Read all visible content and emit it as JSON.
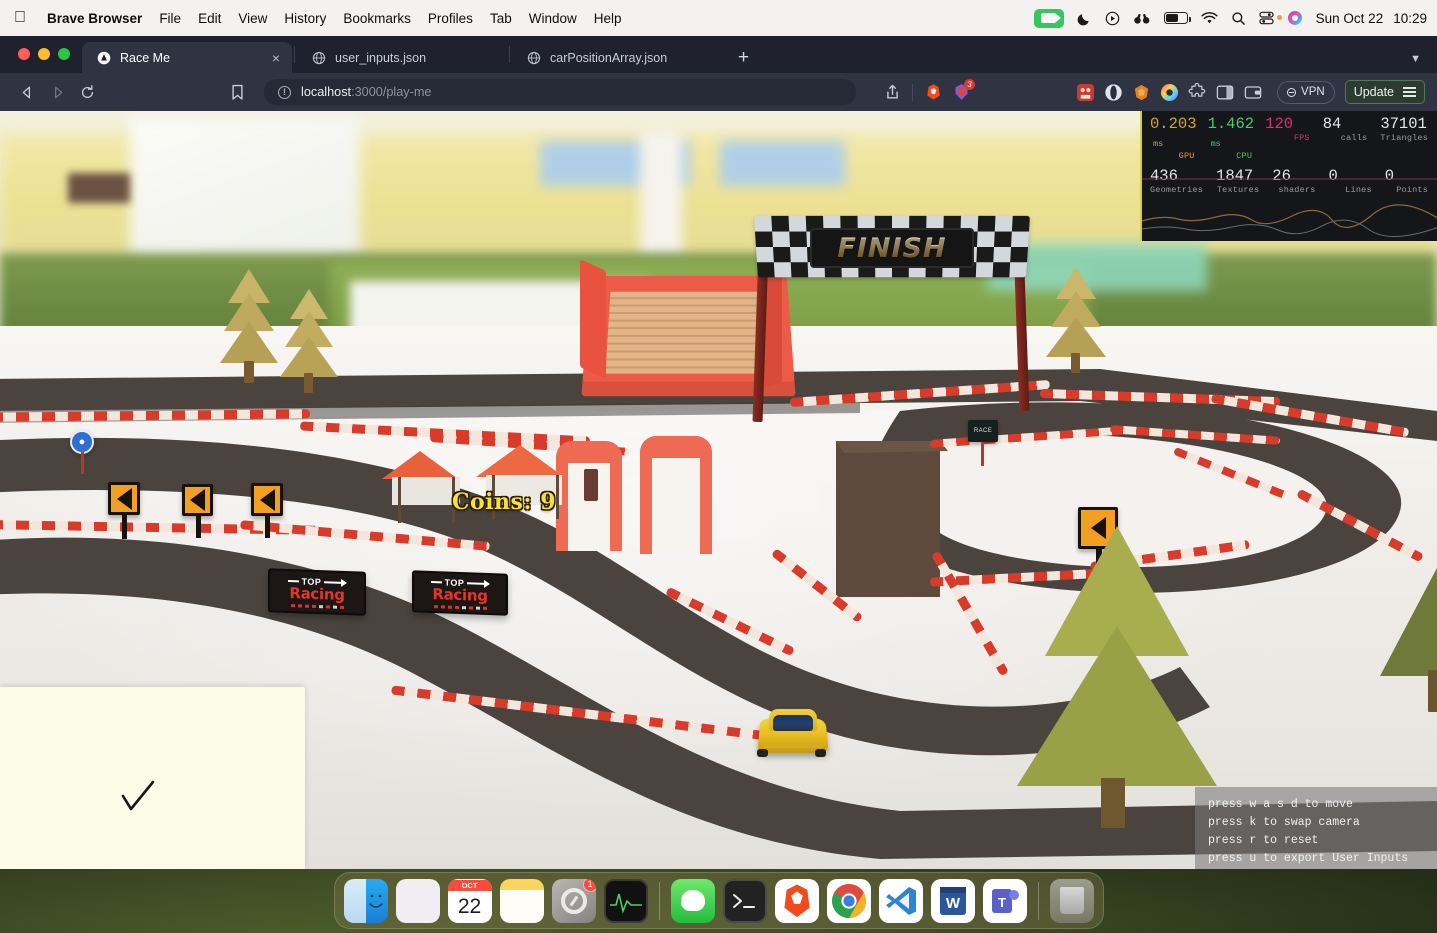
{
  "menubar": {
    "apple_icon": "apple-logo",
    "app_name": "Brave Browser",
    "items": [
      "File",
      "Edit",
      "View",
      "History",
      "Bookmarks",
      "Profiles",
      "Tab",
      "Window",
      "Help"
    ],
    "status_icons": [
      "screen-recording-icon",
      "do-not-disturb-moon-icon",
      "now-playing-icon",
      "binoculars-icon",
      "battery-icon",
      "wifi-icon",
      "spotlight-search-icon",
      "control-center-icon",
      "siri-icon"
    ],
    "date": "Sun Oct 22",
    "time": "10:29"
  },
  "browser": {
    "tabs": [
      {
        "label": "Race Me",
        "favicon": "brave-triangle-icon",
        "active": true,
        "close": "×"
      },
      {
        "label": "user_inputs.json",
        "favicon": "globe-icon",
        "active": false
      },
      {
        "label": "carPositionArray.json",
        "favicon": "globe-icon",
        "active": false
      }
    ],
    "new_tab_label": "+",
    "toolbar": {
      "back_icon": "back-arrow-icon",
      "forward_icon": "forward-arrow-icon",
      "reload_icon": "reload-icon",
      "bookmark_icon": "bookmark-icon",
      "url_host": "localhost",
      "url_path": ":3000/play-me",
      "share_icon": "share-icon",
      "brave_shields_icon": "brave-lion-icon",
      "extension_badge_count": "3",
      "extension_icons": [
        "red-puzzle-extension-icon",
        "opera-wallet-icon",
        "metamask-fox-icon",
        "rainbow-wallet-icon",
        "extensions-puzzle-icon",
        "sidebar-panel-icon",
        "wallet-icon"
      ],
      "vpn_label": "VPN",
      "update_label": "Update",
      "menu_icon": "hamburger-menu-icon"
    }
  },
  "game": {
    "coins_label": "Coins: 9",
    "finish_banner": "FINISH",
    "billboards": [
      {
        "top": "TOP",
        "bottom": "Racing"
      },
      {
        "top": "TOP",
        "bottom": "Racing"
      }
    ],
    "track_sign_icon": "chevron-left-warning-sign",
    "blue_sign_icon": "blue-circular-road-sign",
    "dark_sign_icon": "sponsor-board-sign",
    "car_icon": "yellow-race-car"
  },
  "stats": {
    "rows": [
      [
        {
          "value": "0.203",
          "unit": "ms",
          "label": "GPU",
          "color": "#d9a520"
        },
        {
          "value": "1.462",
          "unit": "ms",
          "label": "CPU",
          "color": "#4fc96b"
        },
        {
          "value": "120",
          "unit": "",
          "label": "FPS",
          "color": "#e0306c"
        },
        {
          "value": "84",
          "unit": "",
          "label": "calls",
          "color": "#e6e6e6"
        },
        {
          "value": "37101",
          "unit": "",
          "label": "Triangles",
          "color": "#e6e6e6"
        }
      ],
      [
        {
          "value": "436",
          "unit": "",
          "label": "Geometries",
          "color": "#e6e6e6"
        },
        {
          "value": "1847",
          "unit": "",
          "label": "Textures",
          "color": "#e6e6e6"
        },
        {
          "value": "26",
          "unit": "",
          "label": "shaders",
          "color": "#e6e6e6"
        },
        {
          "value": "0",
          "unit": "",
          "label": "Lines",
          "color": "#e6e6e6"
        },
        {
          "value": "0",
          "unit": "",
          "label": "Points",
          "color": "#e6e6e6"
        }
      ]
    ]
  },
  "hints": {
    "lines": [
      "press w a s d to move",
      "press k to swap camera",
      "press r to reset",
      "press u to export User Inputs"
    ]
  },
  "dock": {
    "items": [
      {
        "name": "finder",
        "label": "Finder",
        "running": true
      },
      {
        "name": "launchpad",
        "label": "Launchpad",
        "running": false
      },
      {
        "name": "calendar",
        "label": "Calendar",
        "month": "OCT",
        "day": "22",
        "running": false
      },
      {
        "name": "notes",
        "label": "Notes",
        "running": true
      },
      {
        "name": "system-settings",
        "label": "System Settings",
        "badge": "1",
        "running": false
      },
      {
        "name": "activity-monitor",
        "label": "Activity Monitor",
        "running": true
      },
      {
        "name": "messages",
        "label": "Messages",
        "running": true
      },
      {
        "name": "terminal",
        "label": "Terminal",
        "running": true
      },
      {
        "name": "brave",
        "label": "Brave Browser",
        "running": true
      },
      {
        "name": "chrome",
        "label": "Google Chrome",
        "running": true
      },
      {
        "name": "vscode",
        "label": "Visual Studio Code",
        "running": true
      },
      {
        "name": "word",
        "label": "Microsoft Word",
        "running": true
      },
      {
        "name": "teams",
        "label": "Microsoft Teams",
        "running": true
      },
      {
        "name": "trash",
        "label": "Trash",
        "running": false
      }
    ]
  }
}
